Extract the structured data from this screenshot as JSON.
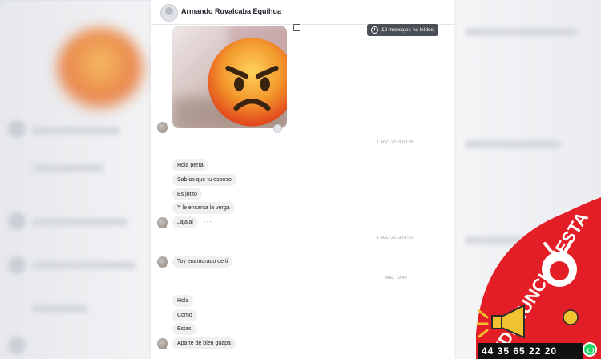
{
  "header": {
    "contact_name": "Armando Ruvalcaba Equihua"
  },
  "unread_badge": {
    "label": "12 mensajes no leídos"
  },
  "timestamps": [
    "1 AGO 2019 00:28",
    "1 AGO 2019 02:22",
    "MIÉ, 19:43"
  ],
  "messages_group1": [
    "Hola perra",
    "Sabías que tu esposo",
    "Es jotito",
    "Y le encanta la verga",
    "Jajajaj"
  ],
  "typing_indicator": "···",
  "messages_group2": [
    "Toy enamorado de ti"
  ],
  "messages_group3": [
    "Hola",
    "Como",
    "Estas",
    "Aparte de bien guapa"
  ],
  "watermark": {
    "hashtag": "#DENUNCIAMESTA",
    "phone": "44 35 65 22 20"
  },
  "colors": {
    "brand_red": "#e41e26",
    "unread_bg": "#4b4f56",
    "bubble_bg": "#f1f0f0"
  },
  "icons": [
    "angry-face-emoji",
    "clock-icon",
    "whatsapp-icon",
    "megaphone-icon"
  ]
}
